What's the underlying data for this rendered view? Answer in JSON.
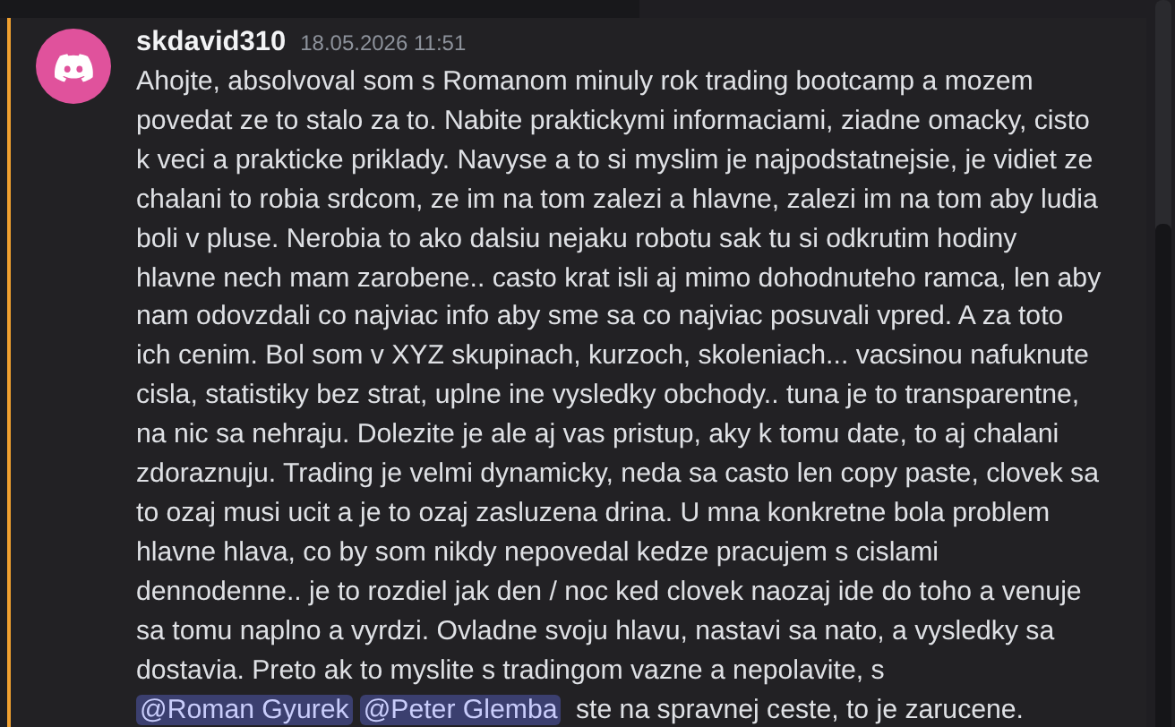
{
  "message": {
    "author": "skdavid310",
    "timestamp": "18.05.2026 11:51",
    "highlighted": true,
    "segments": [
      {
        "kind": "text",
        "text": "Ahojte, absolvoval som s Romanom minuly rok trading bootcamp a mozem povedat ze to stalo za to. Nabite praktickymi informaciami, ziadne omacky, cisto k veci a prakticke priklady. Navyse a to si myslim je najpodstatnejsie, je vidiet ze chalani to robia srdcom, ze im na tom zalezi a hlavne, zalezi im na tom aby ludia boli v pluse. Nerobia to ako dalsiu nejaku robotu sak tu si odkrutim hodiny hlavne nech mam zarobene.. casto krat isli aj mimo dohodnuteho ramca, len aby nam odovzdali co najviac info aby sme sa co najviac posuvali vpred. A za toto ich cenim. Bol som v XYZ skupinach, kurzoch, skoleniach... vacsinou nafuknute cisla, statistiky bez strat, uplne ine vysledky obchody.. tuna je to transparentne, na nic sa nehraju. Dolezite je ale aj vas pristup, aky k tomu date, to aj chalani zdoraznuju. Trading je velmi dynamicky, neda sa casto len copy paste, clovek sa to ozaj musi ucit a je to ozaj zasluzena drina. U mna konkretne bola problem hlavne hlava, co by som nikdy nepovedal kedze pracujem s cislami dennodenne.. je to rozdiel jak den / noc ked clovek naozaj ide do toho a venuje sa tomu naplno a vyrdzi. Ovladne svoju hlavu, nastavi sa nato, a vysledky sa dostavia. Preto ak to myslite s tradingom vazne a nepolavite, s "
      },
      {
        "kind": "mention",
        "text": "@Roman Gyurek"
      },
      {
        "kind": "mention",
        "text": "@Peter Glemba"
      },
      {
        "kind": "text",
        "text": "  ste na spravnej ceste, to je zarucene."
      }
    ]
  }
}
